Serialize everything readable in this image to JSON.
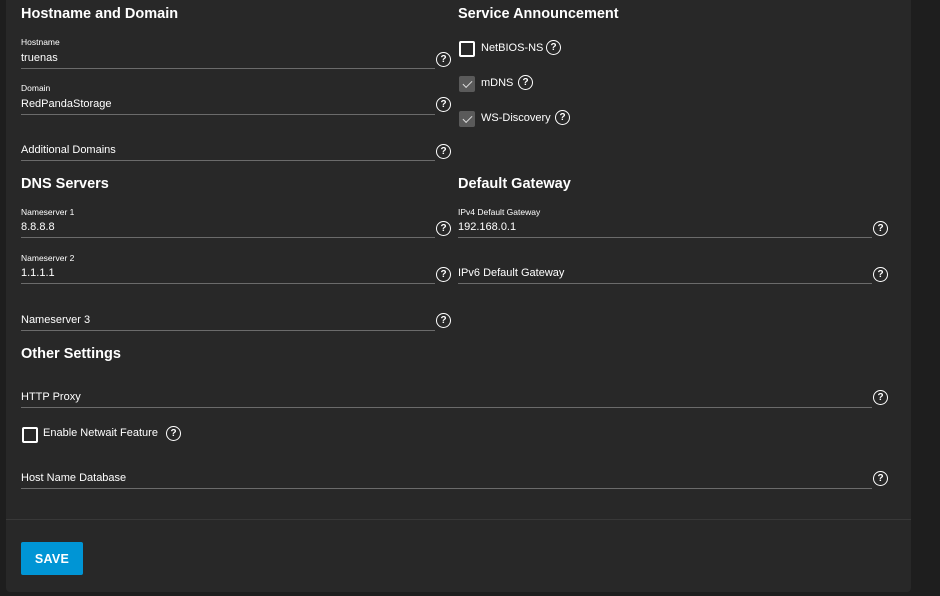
{
  "sections": {
    "hostname_domain": "Hostname and Domain",
    "service_announcement": "Service Announcement",
    "dns_servers": "DNS Servers",
    "default_gateway": "Default Gateway",
    "other_settings": "Other Settings"
  },
  "fields": {
    "hostname": {
      "label": "Hostname",
      "value": "truenas"
    },
    "domain": {
      "label": "Domain",
      "value": "RedPandaStorage"
    },
    "additional_domains": {
      "label": "Additional Domains",
      "value": ""
    },
    "nameserver1": {
      "label": "Nameserver 1",
      "value": "8.8.8.8"
    },
    "nameserver2": {
      "label": "Nameserver 2",
      "value": "1.1.1.1"
    },
    "nameserver3": {
      "label": "Nameserver 3",
      "value": ""
    },
    "ipv4_gateway": {
      "label": "IPv4 Default Gateway",
      "value": "192.168.0.1"
    },
    "ipv6_gateway": {
      "label": "IPv6 Default Gateway",
      "value": ""
    },
    "http_proxy": {
      "label": "HTTP Proxy",
      "value": ""
    },
    "host_name_database": {
      "label": "Host Name Database",
      "value": ""
    }
  },
  "checkboxes": {
    "netbios_ns": {
      "label": "NetBIOS-NS",
      "checked": false
    },
    "mdns": {
      "label": "mDNS",
      "checked": true
    },
    "ws_discovery": {
      "label": "WS-Discovery",
      "checked": true
    },
    "netwait": {
      "label": "Enable Netwait Feature",
      "checked": false
    }
  },
  "help_glyph": "?",
  "icons": {
    "help": "help-circle-icon",
    "check": "check-icon"
  },
  "colors": {
    "accent": "#0095d5",
    "card": "#282828",
    "background": "#1e1e1e",
    "underline": "#6b6b6b"
  },
  "actions": {
    "save_label": "SAVE"
  }
}
